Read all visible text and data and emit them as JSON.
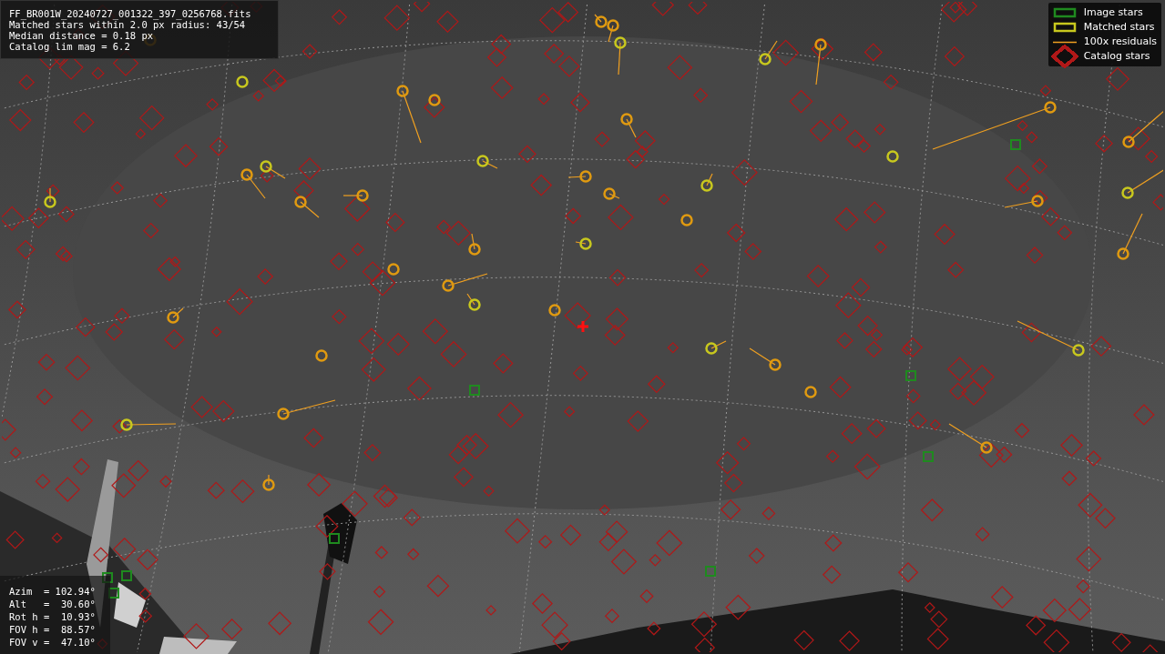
{
  "info_panel": {
    "lines": [
      "FF_BR001W_20240727_001322_397_0256768.fits",
      "Matched stars within 2.0 px radius: 43/54",
      "Median distance = 0.18 px",
      "Catalog lim mag = 6.2"
    ]
  },
  "legend": [
    {
      "kind": "box",
      "color": "#1f8a1f",
      "label": "Image stars"
    },
    {
      "kind": "box",
      "color": "#c8c81e",
      "label": "Matched stars"
    },
    {
      "kind": "line",
      "color": "#f0a020",
      "label": "100x residuals"
    },
    {
      "kind": "diamond",
      "color": "#b01818",
      "label": "Catalog stars"
    }
  ],
  "pointing_panel": {
    "lines": [
      "Azim  = 102.94°",
      "Alt   =  30.60°",
      "Rot h =  10.93°",
      "FOV h =  88.57°",
      "FOV v =  47.10°"
    ]
  }
}
